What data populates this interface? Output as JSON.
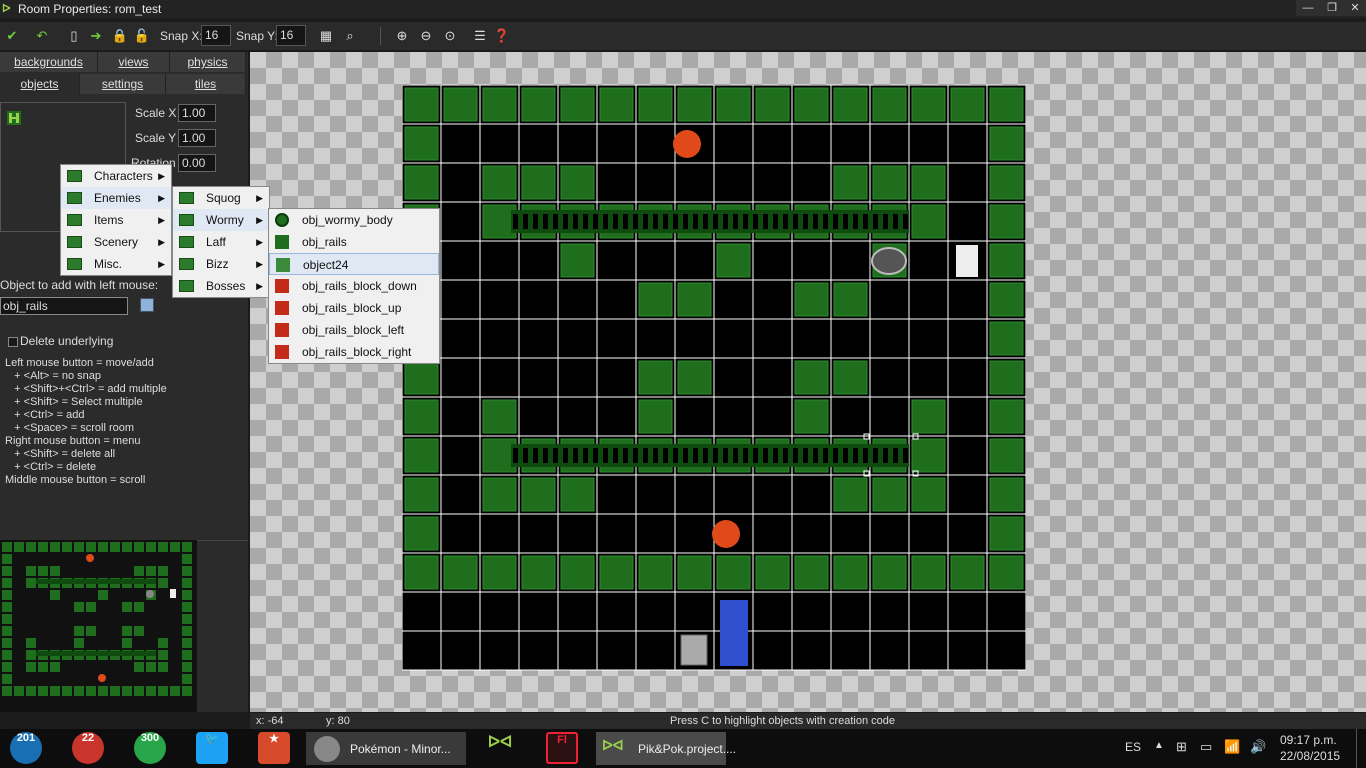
{
  "window": {
    "title": "Room Properties: rom_test",
    "min": "—",
    "max": "❐",
    "close": "✕"
  },
  "toolbar": {
    "snap_x_label": "Snap X:",
    "snap_x": "16",
    "snap_y_label": "Snap Y:",
    "snap_y": "16"
  },
  "tabs": {
    "row1": [
      "backgrounds",
      "views",
      "physics"
    ],
    "row2": [
      "objects",
      "settings",
      "tiles"
    ]
  },
  "objects_panel": {
    "scale_x_label": "Scale X",
    "scale_x": "1.00",
    "scale_y_label": "Scale Y",
    "scale_y": "1.00",
    "rotation_label": "Rotation",
    "rotation": "0.00",
    "add_label": "Object to add with left mouse:",
    "object_name": "obj_rails",
    "delete_underlying": "Delete underlying",
    "help": [
      "Left mouse button = move/add",
      "   + <Alt> = no snap",
      "   + <Shift>+<Ctrl> = add multiple",
      "   + <Shift> = Select multiple",
      "   + <Ctrl> = add",
      "   + <Space> = scroll room",
      "Right mouse button = menu",
      "   + <Shift> = delete all",
      "   + <Ctrl> = delete",
      "Middle mouse button = scroll"
    ]
  },
  "menu1": [
    "Characters",
    "Enemies",
    "Items",
    "Scenery",
    "Misc."
  ],
  "menu2": [
    "Squog",
    "Wormy",
    "Laff",
    "Bizz",
    "Bosses"
  ],
  "menu3": [
    "obj_wormy_body",
    "obj_rails",
    "object24",
    "obj_rails_block_down",
    "obj_rails_block_up",
    "obj_rails_block_left",
    "obj_rails_block_right"
  ],
  "status": {
    "x": "x: -64",
    "y": "y: 80",
    "hint": "Press C to highlight objects with creation code"
  },
  "taskbar": {
    "badge1": "201",
    "badge2": "22",
    "badge3": "300",
    "task1": "Pokémon - Minor...",
    "task2": "Pik&Pok.project....",
    "lang": "ES",
    "time": "09:17 p.m.",
    "date": "22/08/2015"
  },
  "colors": {
    "wall": "#1e6e1e",
    "floor": "#000000",
    "grid": "#ffffff",
    "accent": "#9ad04a"
  }
}
